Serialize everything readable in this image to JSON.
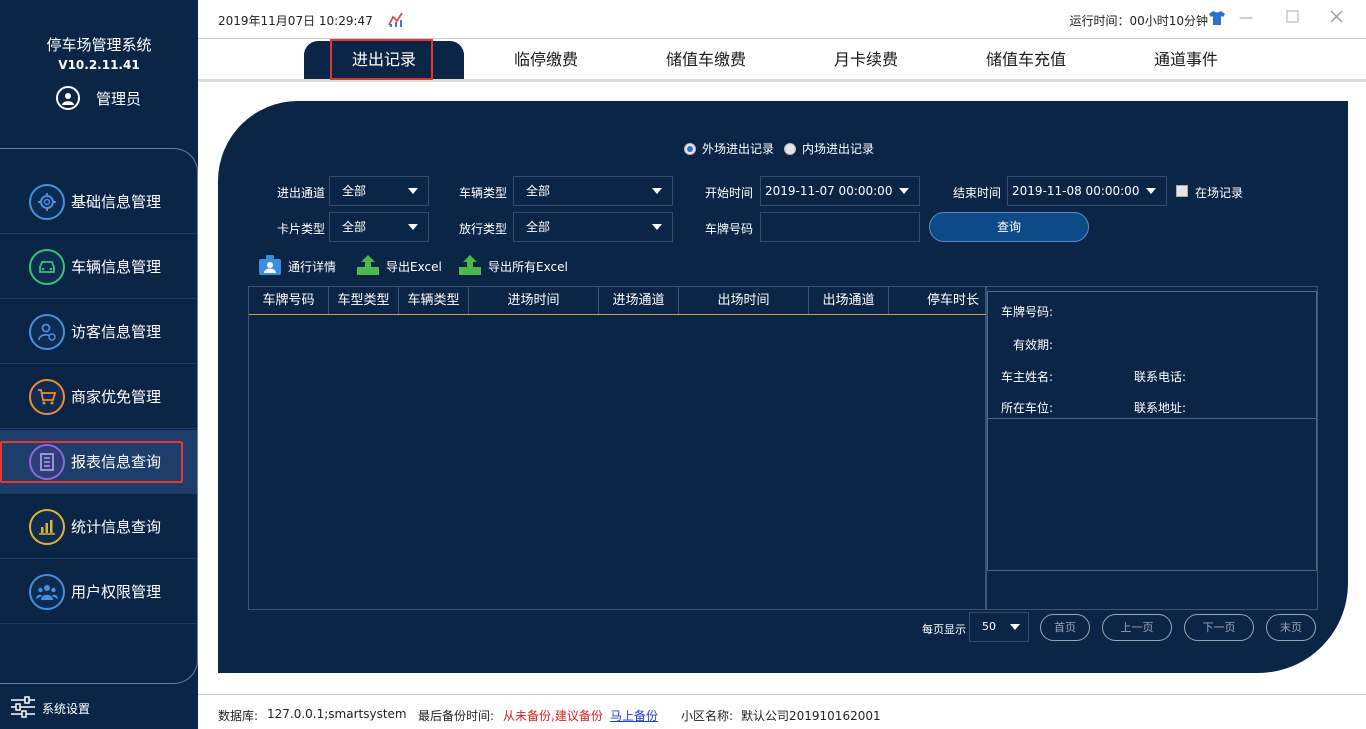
{
  "app": {
    "title": "停车场管理系统",
    "version": "V10.2.11.41",
    "user": "管理员"
  },
  "sidebar": {
    "items": [
      {
        "label": "基础信息管理",
        "icon": "gear-icon",
        "color": "#4a90d9"
      },
      {
        "label": "车辆信息管理",
        "icon": "car-icon",
        "color": "#3cc17a"
      },
      {
        "label": "访客信息管理",
        "icon": "visitor-icon",
        "color": "#4a90d9"
      },
      {
        "label": "商家优免管理",
        "icon": "cart-icon",
        "color": "#f08a32"
      },
      {
        "label": "报表信息查询",
        "icon": "report-icon",
        "color": "#8a6ad8",
        "active": true
      },
      {
        "label": "统计信息查询",
        "icon": "bar-chart-icon",
        "color": "#e0b52c"
      },
      {
        "label": "用户权限管理",
        "icon": "users-icon",
        "color": "#4a90d9"
      }
    ],
    "settings_label": "系统设置"
  },
  "topbar": {
    "datetime": "2019年11月07日 10:29:47",
    "runtime": "运行时间：00小时10分钟"
  },
  "tabs": [
    {
      "label": "进出记录",
      "active": true
    },
    {
      "label": "临停缴费"
    },
    {
      "label": "储值车缴费"
    },
    {
      "label": "月卡续费"
    },
    {
      "label": "储值车充值"
    },
    {
      "label": "通道事件"
    }
  ],
  "filters": {
    "radio_outer": "外场进出记录",
    "radio_inner": "内场进出记录",
    "channel_label": "进出通道",
    "channel_value": "全部",
    "vehicle_type_label": "车辆类型",
    "vehicle_type_value": "全部",
    "start_label": "开始时间",
    "start_value": "2019-11-07 00:00:00",
    "end_label": "结束时间",
    "end_value": "2019-11-08 00:00:00",
    "onsite_label": "在场记录",
    "card_type_label": "卡片类型",
    "card_type_value": "全部",
    "release_type_label": "放行类型",
    "release_type_value": "全部",
    "plate_label": "车牌号码",
    "plate_value": "",
    "query_button": "查询"
  },
  "toolbar": {
    "detail": "通行详情",
    "export": "导出Excel",
    "export_all": "导出所有Excel"
  },
  "table": {
    "columns": [
      "车牌号码",
      "车型类型",
      "车辆类型",
      "进场时间",
      "进场通道",
      "出场时间",
      "出场通道",
      "停车时长"
    ],
    "rows": []
  },
  "detail": {
    "plate": "车牌号码:",
    "validity": "有效期:",
    "owner": "车主姓名:",
    "phone": "联系电话:",
    "space": "所在车位:",
    "address": "联系地址:"
  },
  "pagination": {
    "per_page_label": "每页显示",
    "per_page_value": "50",
    "first": "首页",
    "prev": "上一页",
    "next": "下一页",
    "last": "末页"
  },
  "status": {
    "db_label": "数据库:",
    "db_value": "127.0.0.1;smartsystem",
    "backup_label": "最后备份时间:",
    "backup_value": "从未备份,建议备份",
    "backup_link": "马上备份",
    "community_label": "小区名称:",
    "community_value": "默认公司201910162001"
  }
}
